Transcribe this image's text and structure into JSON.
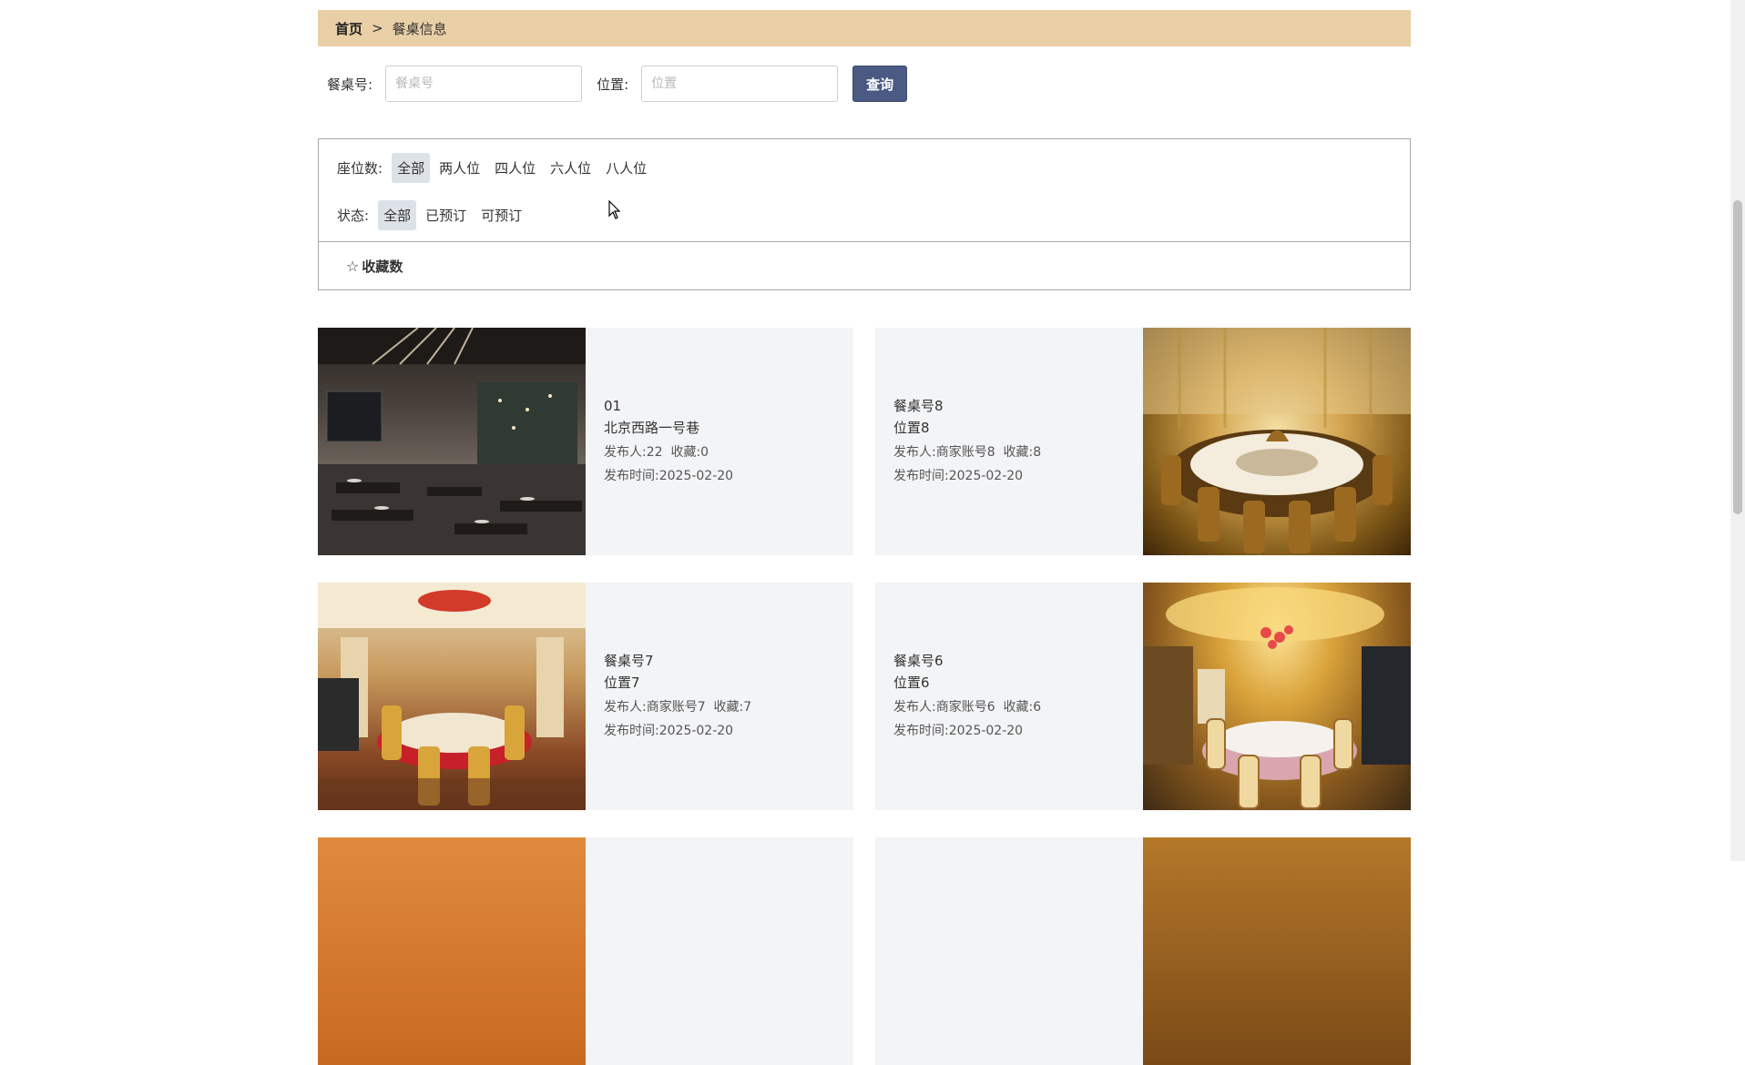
{
  "breadcrumb": {
    "home": "首页",
    "separator": ">",
    "current": "餐桌信息"
  },
  "search": {
    "table_label": "餐桌号:",
    "table_placeholder": "餐桌号",
    "table_value": "",
    "position_label": "位置:",
    "position_placeholder": "位置",
    "position_value": "",
    "button_label": "查询"
  },
  "filters": {
    "seats": {
      "label": "座位数:",
      "options": [
        "全部",
        "两人位",
        "四人位",
        "六人位",
        "八人位"
      ],
      "selected": "全部"
    },
    "status": {
      "label": "状态:",
      "options": [
        "全部",
        "已预订",
        "可预订"
      ],
      "selected": "全部"
    }
  },
  "sort": {
    "icon": "star-outline-icon",
    "label": "收藏数"
  },
  "cards": [
    {
      "name": "01",
      "position": "北京西路一号巷",
      "publisher_label": "发布人:",
      "publisher": "22",
      "favorites_label": "收藏:",
      "favorites": "0",
      "time_label": "发布时间:",
      "time": "2025-02-20"
    },
    {
      "name": "餐桌号8",
      "position": "位置8",
      "publisher_label": "发布人:",
      "publisher": "商家账号8",
      "favorites_label": "收藏:",
      "favorites": "8",
      "time_label": "发布时间:",
      "time": "2025-02-20"
    },
    {
      "name": "餐桌号7",
      "position": "位置7",
      "publisher_label": "发布人:",
      "publisher": "商家账号7",
      "favorites_label": "收藏:",
      "favorites": "7",
      "time_label": "发布时间:",
      "time": "2025-02-20"
    },
    {
      "name": "餐桌号6",
      "position": "位置6",
      "publisher_label": "发布人:",
      "publisher": "商家账号6",
      "favorites_label": "收藏:",
      "favorites": "6",
      "time_label": "发布时间:",
      "time": "2025-02-20"
    }
  ],
  "colors": {
    "breadcrumb_bg": "#e9cfa6",
    "button_bg": "#4a5a83",
    "card_bg": "#f3f4f6",
    "chip_active_bg": "#dde1e8"
  }
}
